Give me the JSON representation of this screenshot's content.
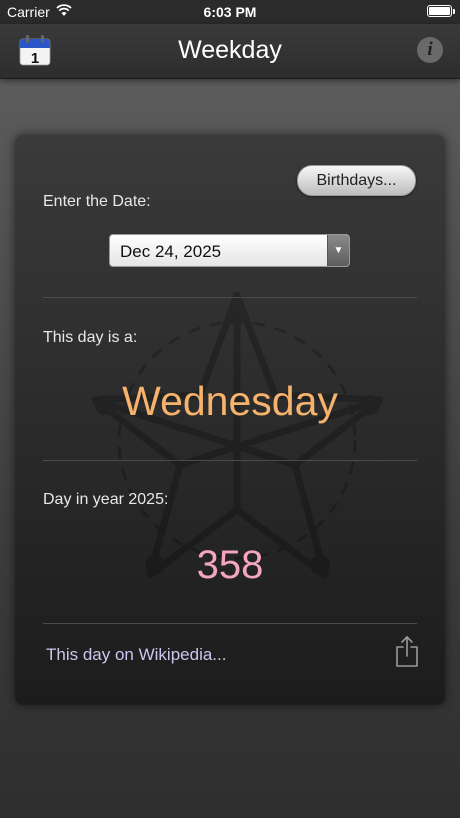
{
  "status_bar": {
    "carrier": "Carrier",
    "time": "6:03 PM"
  },
  "nav": {
    "title": "Weekday",
    "calendar_icon_day": "1",
    "info_glyph": "i"
  },
  "card": {
    "birthdays_label": "Birthdays...",
    "enter_date_label": "Enter the Date:",
    "date_value": "Dec 24, 2025",
    "this_day_label": "This day is a:",
    "weekday": "Wednesday",
    "day_in_year_label": "Day in year 2025:",
    "day_in_year_value": "358",
    "wikipedia_link": "This day on Wikipedia..."
  },
  "colors": {
    "weekday_text": "#f5b36c",
    "day_number_text": "#f4a5c2",
    "link_text": "#c9c7ee"
  },
  "icons": [
    "wifi-icon",
    "battery-icon",
    "calendar-icon",
    "info-icon",
    "dropdown-arrow-icon",
    "share-icon",
    "star-emblem"
  ]
}
